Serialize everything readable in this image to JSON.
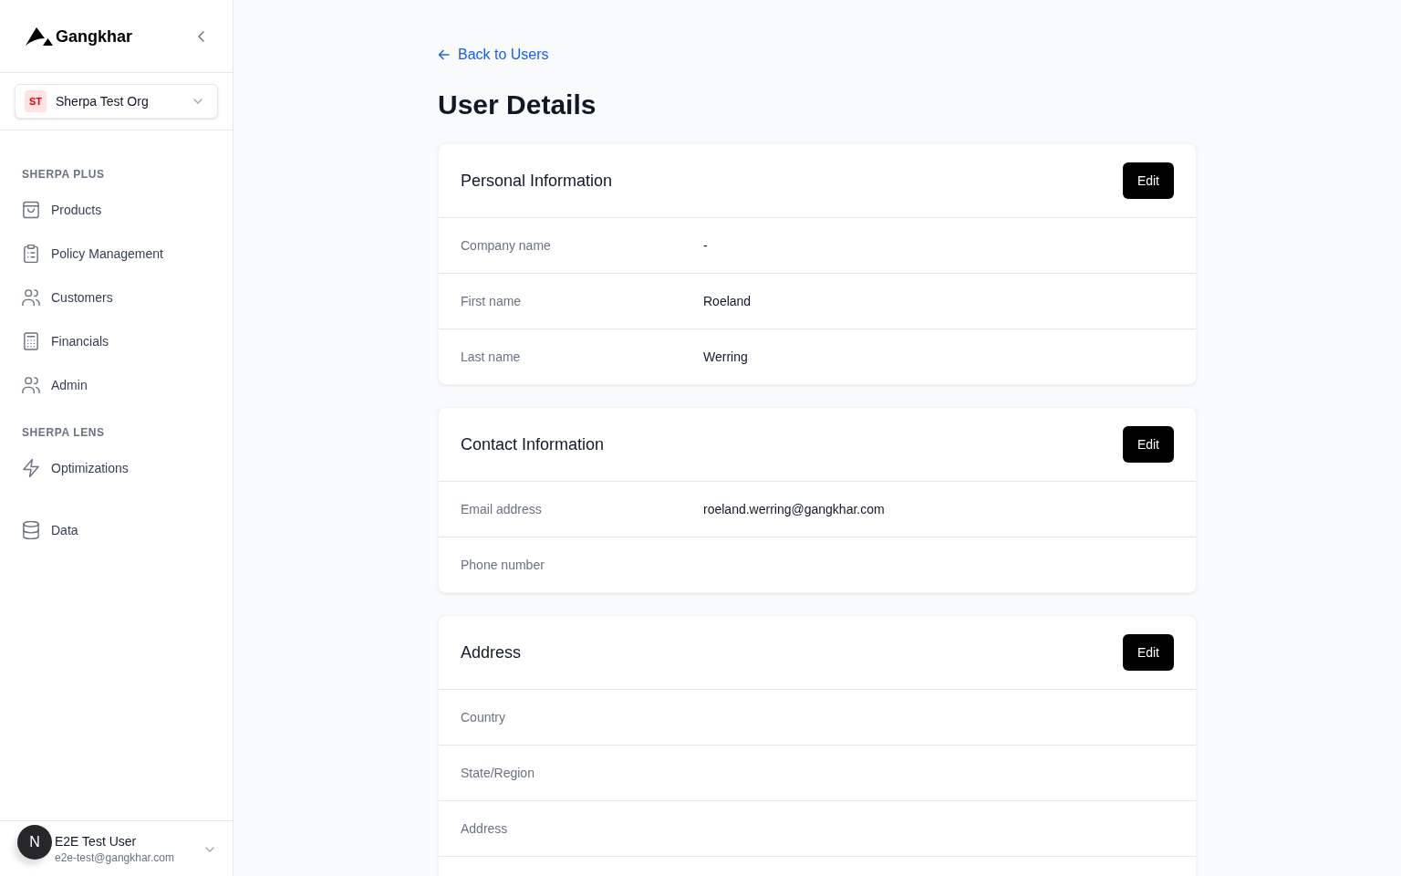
{
  "sidebar": {
    "brand": "Gangkhar",
    "org_switcher": {
      "initials": "ST",
      "name": "Sherpa Test Org"
    },
    "nav_sections": [
      {
        "title": "SHERPA PLUS",
        "items": [
          "Products",
          "Policy Management",
          "Customers",
          "Financials",
          "Admin"
        ]
      },
      {
        "title": "SHERPA LENS",
        "items": [
          "Optimizations"
        ]
      },
      {
        "items": [
          "Data"
        ]
      }
    ],
    "user": {
      "avatar_initial": "N",
      "name": "E2E Test User",
      "email": "e2e-test@gangkhar.com"
    }
  },
  "main": {
    "back_link": "Back to Users",
    "title": "User Details",
    "cards": [
      {
        "title": "Personal Information",
        "button": "Edit",
        "rows": [
          {
            "label": "Company name",
            "value": "-"
          },
          {
            "label": "First name",
            "value": "Roeland"
          },
          {
            "label": "Last name",
            "value": "Werring"
          }
        ],
        "continues_below": false
      },
      {
        "title": "Contact Information",
        "button": "Edit",
        "rows": [
          {
            "label": "Email address",
            "value": "roeland.werring@gangkhar.com"
          },
          {
            "label": "Phone number"
          }
        ],
        "continues_below": false
      },
      {
        "title": "Address",
        "button": "Edit",
        "rows": [
          {
            "label": "Country"
          },
          {
            "label": "State/Region"
          },
          {
            "label": "Address"
          }
        ],
        "continues_below": true
      }
    ]
  }
}
